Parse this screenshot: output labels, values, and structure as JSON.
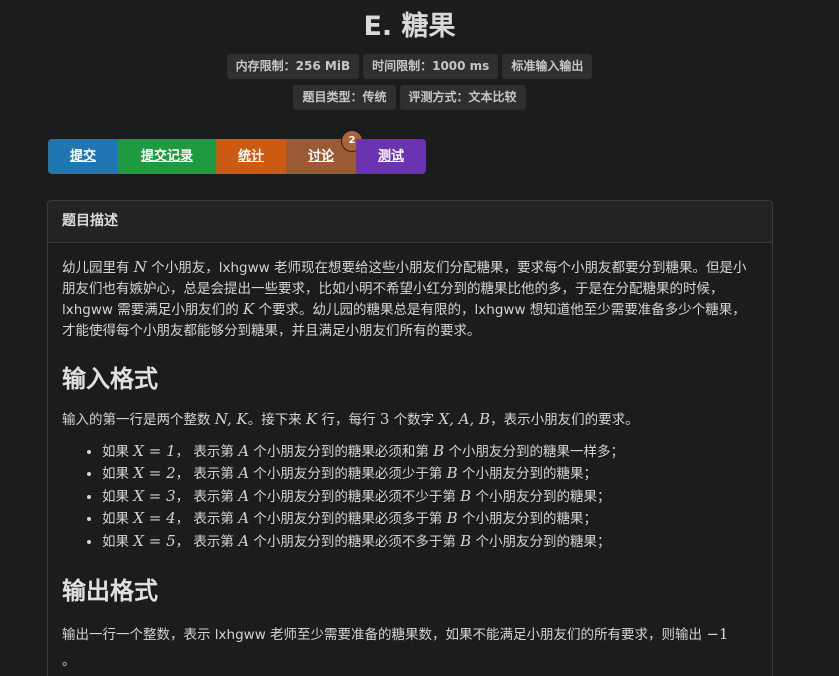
{
  "title": "E. 糖果",
  "labels_row1": [
    "内存限制：256 MiB",
    "时间限制：1000 ms",
    "标准输入输出"
  ],
  "labels_row2": [
    "题目类型：传统",
    "评测方式：文本比较"
  ],
  "buttons": {
    "submit": "提交",
    "records": "提交记录",
    "stats": "统计",
    "discuss": "讨论",
    "discuss_badge": "2",
    "test": "测试"
  },
  "card": {
    "header": "题目描述",
    "description": {
      "p1": "幼儿园里有 ",
      "n": "N",
      "p2": " 个小朋友，lxhgww 老师现在想要给这些小朋友们分配糖果，要求每个小朋友都要分到糖果。但是小朋友们也有嫉妒心，总是会提出一些要求，比如小明不希望小红分到的糖果比他的多，于是在分配糖果的时候，lxhgww 需要满足小朋友们的 ",
      "k": "K",
      "p3": " 个要求。幼儿园的糖果总是有限的，lxhgww 想知道他至少需要准备多少个糖果，才能使得每个小朋友都能够分到糖果，并且满足小朋友们所有的要求。"
    },
    "input_heading": "输入格式",
    "input": {
      "p1": "输入的第一行是两个整数 ",
      "nk": "N, K",
      "p2": "。接下来 ",
      "k": "K",
      "p3": " 行，每行 ",
      "three": "3",
      "p4": " 个数字 ",
      "xab": "X, A, B",
      "p5": "，表示小朋友们的要求。"
    },
    "rules": [
      {
        "pre": "如果 ",
        "cond": "X = 1",
        "mid1": "， 表示第 ",
        "a": "A",
        "mid2": " 个小朋友分到的糖果必须和第 ",
        "b": "B",
        "post": " 个小朋友分到的糖果一样多；"
      },
      {
        "pre": "如果 ",
        "cond": "X = 2",
        "mid1": "， 表示第 ",
        "a": "A",
        "mid2": " 个小朋友分到的糖果必须少于第 ",
        "b": "B",
        "post": " 个小朋友分到的糖果；"
      },
      {
        "pre": "如果 ",
        "cond": "X = 3",
        "mid1": "， 表示第 ",
        "a": "A",
        "mid2": " 个小朋友分到的糖果必须不少于第 ",
        "b": "B",
        "post": " 个小朋友分到的糖果；"
      },
      {
        "pre": "如果 ",
        "cond": "X = 4",
        "mid1": "， 表示第 ",
        "a": "A",
        "mid2": " 个小朋友分到的糖果必须多于第 ",
        "b": "B",
        "post": " 个小朋友分到的糖果；"
      },
      {
        "pre": "如果 ",
        "cond": "X = 5",
        "mid1": "， 表示第 ",
        "a": "A",
        "mid2": " 个小朋友分到的糖果必须不多于第 ",
        "b": "B",
        "post": " 个小朋友分到的糖果；"
      }
    ],
    "output_heading": "输出格式",
    "output": {
      "p1": "输出一行一个整数，表示 lxhgww 老师至少需要准备的糖果数，如果不能满足小朋友们的所有要求，则输出 ",
      "neg": "−1",
      "p2": "。"
    }
  }
}
